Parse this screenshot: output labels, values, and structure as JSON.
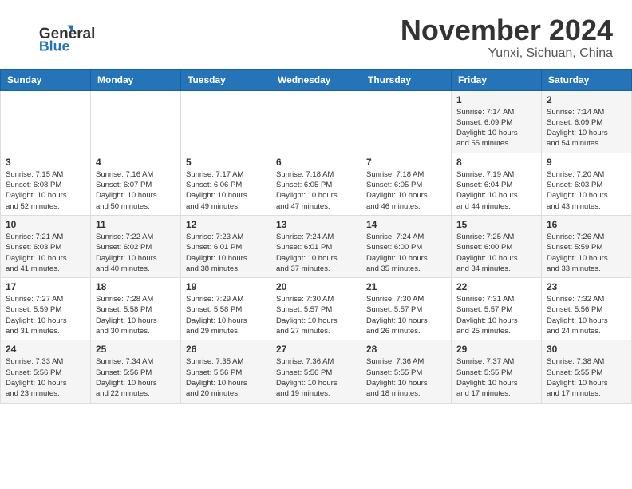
{
  "header": {
    "logo_general": "General",
    "logo_blue": "Blue",
    "month_title": "November 2024",
    "location": "Yunxi, Sichuan, China"
  },
  "weekdays": [
    "Sunday",
    "Monday",
    "Tuesday",
    "Wednesday",
    "Thursday",
    "Friday",
    "Saturday"
  ],
  "weeks": [
    {
      "days": [
        {
          "num": "",
          "info": ""
        },
        {
          "num": "",
          "info": ""
        },
        {
          "num": "",
          "info": ""
        },
        {
          "num": "",
          "info": ""
        },
        {
          "num": "",
          "info": ""
        },
        {
          "num": "1",
          "info": "Sunrise: 7:14 AM\nSunset: 6:09 PM\nDaylight: 10 hours\nand 55 minutes."
        },
        {
          "num": "2",
          "info": "Sunrise: 7:14 AM\nSunset: 6:09 PM\nDaylight: 10 hours\nand 54 minutes."
        }
      ]
    },
    {
      "days": [
        {
          "num": "3",
          "info": "Sunrise: 7:15 AM\nSunset: 6:08 PM\nDaylight: 10 hours\nand 52 minutes."
        },
        {
          "num": "4",
          "info": "Sunrise: 7:16 AM\nSunset: 6:07 PM\nDaylight: 10 hours\nand 50 minutes."
        },
        {
          "num": "5",
          "info": "Sunrise: 7:17 AM\nSunset: 6:06 PM\nDaylight: 10 hours\nand 49 minutes."
        },
        {
          "num": "6",
          "info": "Sunrise: 7:18 AM\nSunset: 6:05 PM\nDaylight: 10 hours\nand 47 minutes."
        },
        {
          "num": "7",
          "info": "Sunrise: 7:18 AM\nSunset: 6:05 PM\nDaylight: 10 hours\nand 46 minutes."
        },
        {
          "num": "8",
          "info": "Sunrise: 7:19 AM\nSunset: 6:04 PM\nDaylight: 10 hours\nand 44 minutes."
        },
        {
          "num": "9",
          "info": "Sunrise: 7:20 AM\nSunset: 6:03 PM\nDaylight: 10 hours\nand 43 minutes."
        }
      ]
    },
    {
      "days": [
        {
          "num": "10",
          "info": "Sunrise: 7:21 AM\nSunset: 6:03 PM\nDaylight: 10 hours\nand 41 minutes."
        },
        {
          "num": "11",
          "info": "Sunrise: 7:22 AM\nSunset: 6:02 PM\nDaylight: 10 hours\nand 40 minutes."
        },
        {
          "num": "12",
          "info": "Sunrise: 7:23 AM\nSunset: 6:01 PM\nDaylight: 10 hours\nand 38 minutes."
        },
        {
          "num": "13",
          "info": "Sunrise: 7:24 AM\nSunset: 6:01 PM\nDaylight: 10 hours\nand 37 minutes."
        },
        {
          "num": "14",
          "info": "Sunrise: 7:24 AM\nSunset: 6:00 PM\nDaylight: 10 hours\nand 35 minutes."
        },
        {
          "num": "15",
          "info": "Sunrise: 7:25 AM\nSunset: 6:00 PM\nDaylight: 10 hours\nand 34 minutes."
        },
        {
          "num": "16",
          "info": "Sunrise: 7:26 AM\nSunset: 5:59 PM\nDaylight: 10 hours\nand 33 minutes."
        }
      ]
    },
    {
      "days": [
        {
          "num": "17",
          "info": "Sunrise: 7:27 AM\nSunset: 5:59 PM\nDaylight: 10 hours\nand 31 minutes."
        },
        {
          "num": "18",
          "info": "Sunrise: 7:28 AM\nSunset: 5:58 PM\nDaylight: 10 hours\nand 30 minutes."
        },
        {
          "num": "19",
          "info": "Sunrise: 7:29 AM\nSunset: 5:58 PM\nDaylight: 10 hours\nand 29 minutes."
        },
        {
          "num": "20",
          "info": "Sunrise: 7:30 AM\nSunset: 5:57 PM\nDaylight: 10 hours\nand 27 minutes."
        },
        {
          "num": "21",
          "info": "Sunrise: 7:30 AM\nSunset: 5:57 PM\nDaylight: 10 hours\nand 26 minutes."
        },
        {
          "num": "22",
          "info": "Sunrise: 7:31 AM\nSunset: 5:57 PM\nDaylight: 10 hours\nand 25 minutes."
        },
        {
          "num": "23",
          "info": "Sunrise: 7:32 AM\nSunset: 5:56 PM\nDaylight: 10 hours\nand 24 minutes."
        }
      ]
    },
    {
      "days": [
        {
          "num": "24",
          "info": "Sunrise: 7:33 AM\nSunset: 5:56 PM\nDaylight: 10 hours\nand 23 minutes."
        },
        {
          "num": "25",
          "info": "Sunrise: 7:34 AM\nSunset: 5:56 PM\nDaylight: 10 hours\nand 22 minutes."
        },
        {
          "num": "26",
          "info": "Sunrise: 7:35 AM\nSunset: 5:56 PM\nDaylight: 10 hours\nand 20 minutes."
        },
        {
          "num": "27",
          "info": "Sunrise: 7:36 AM\nSunset: 5:56 PM\nDaylight: 10 hours\nand 19 minutes."
        },
        {
          "num": "28",
          "info": "Sunrise: 7:36 AM\nSunset: 5:55 PM\nDaylight: 10 hours\nand 18 minutes."
        },
        {
          "num": "29",
          "info": "Sunrise: 7:37 AM\nSunset: 5:55 PM\nDaylight: 10 hours\nand 17 minutes."
        },
        {
          "num": "30",
          "info": "Sunrise: 7:38 AM\nSunset: 5:55 PM\nDaylight: 10 hours\nand 17 minutes."
        }
      ]
    }
  ]
}
